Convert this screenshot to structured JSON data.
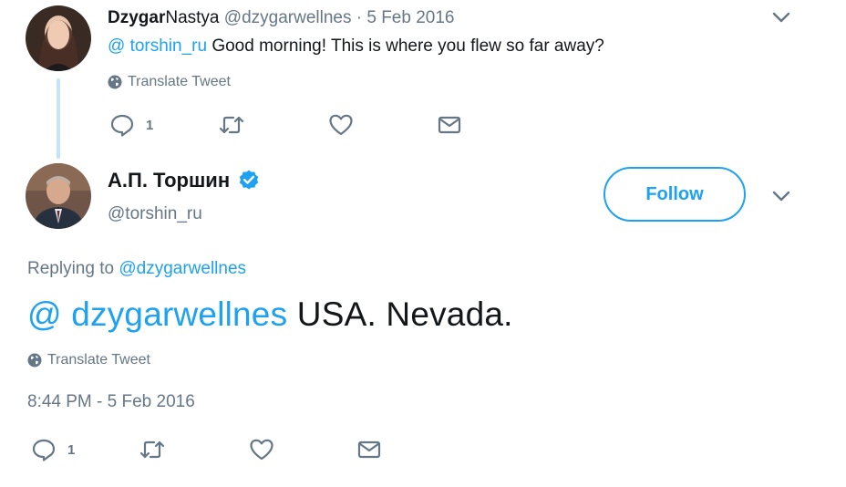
{
  "reply_tweet": {
    "display_name_bold": "Dzygar",
    "display_name_rest": "Nastya",
    "handle": "@dzygarwellnes",
    "separator": "·",
    "date": "5 Feb 2016",
    "mention": "@ torshin_ru",
    "text": " Good morning! This is where you flew so far away?",
    "translate_label": "Translate Tweet",
    "reply_count": "1"
  },
  "main_tweet": {
    "display_name": "А.П. Торшин",
    "handle": "@torshin_ru",
    "follow_label": "Follow",
    "replying_to_label": "Replying to ",
    "replying_to_handle": "@dzygarwellnes",
    "mention": "@ dzygarwellnes",
    "text": " USA. Nevada.",
    "translate_label": "Translate Tweet",
    "timestamp": "8:44 PM - 5 Feb 2016",
    "reply_count": "1"
  },
  "colors": {
    "accent": "#1da1f2",
    "muted": "#657786",
    "verified": "#1da1f2",
    "thread_line": "#c4e4f8"
  },
  "icons": [
    "chevron-down-icon",
    "globe-icon",
    "reply-icon",
    "retweet-icon",
    "like-icon",
    "direct-message-icon",
    "verified-badge-icon"
  ]
}
